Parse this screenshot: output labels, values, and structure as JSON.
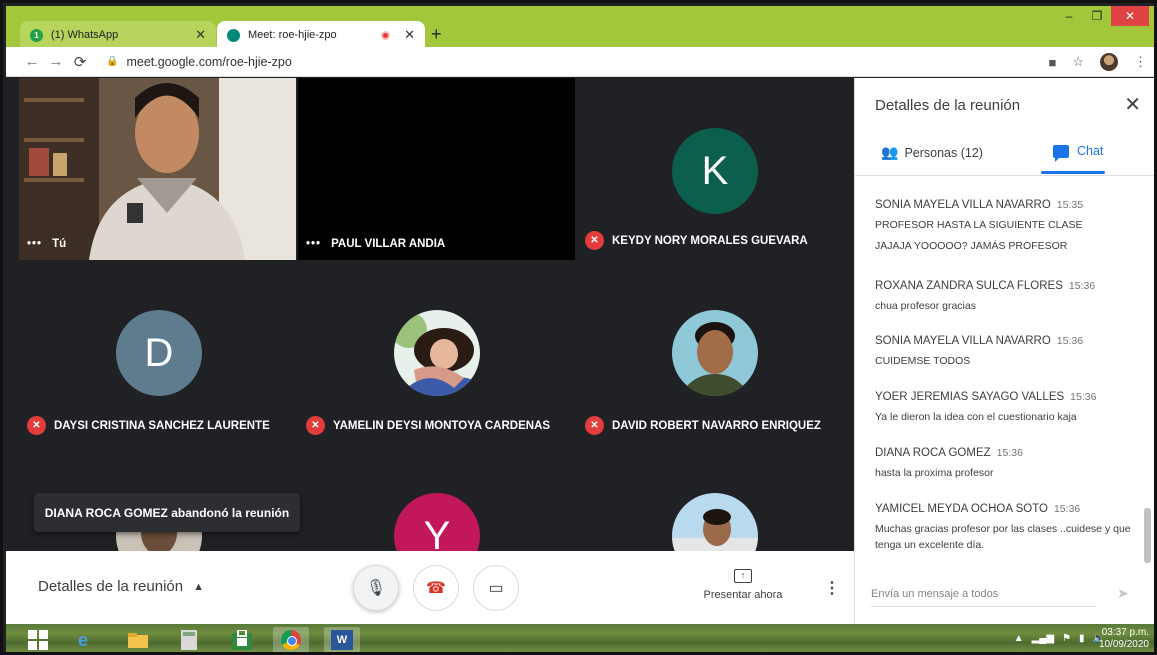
{
  "browser": {
    "tabs": [
      {
        "title": "(1) WhatsApp",
        "badge": "1",
        "active": false
      },
      {
        "title": "Meet: roe-hjie-zpo",
        "active": true,
        "recording": true
      }
    ],
    "new_tab": "+",
    "url": "meet.google.com/roe-hjie-zpo"
  },
  "meeting": {
    "tiles": [
      {
        "name": "Tú",
        "type": "video-self"
      },
      {
        "name": "PAUL VILLAR ANDIA",
        "type": "blank"
      },
      {
        "name": "KEYDY NORY MORALES GUEVARA",
        "type": "letter",
        "letter": "K",
        "color": "#0c5f4c",
        "muted": true
      },
      {
        "name": "DAYSI CRISTINA SANCHEZ LAURENTE",
        "type": "letter",
        "letter": "D",
        "color": "#5f7b8e",
        "muted": true
      },
      {
        "name": "YAMELIN DEYSI MONTOYA CARDENAS",
        "type": "photo",
        "muted": true
      },
      {
        "name": "DAVID ROBERT NAVARRO ENRIQUEZ",
        "type": "photo",
        "muted": true
      },
      {
        "name": "",
        "type": "photo-partial"
      },
      {
        "name": "",
        "type": "letter",
        "letter": "Y",
        "color": "#c2185b"
      },
      {
        "name": "",
        "type": "photo-partial"
      }
    ],
    "toast": "DIANA ROCA GOMEZ abandonó la reunión",
    "bottom": {
      "details_label": "Detalles de la reunión",
      "present_label": "Presentar ahora"
    }
  },
  "panel": {
    "title": "Detalles de la reunión",
    "people_tab": "Personas (12)",
    "chat_tab": "Chat",
    "messages": [
      {
        "sender": "SONIA MAYELA VILLA NAVARRO",
        "time": "15:35",
        "lines": [
          "PROFESOR  HASTA LA SIGUIENTE CLASE"
        ]
      },
      {
        "sender": "",
        "time": "",
        "lines": [
          "JAJAJA YOOOOO? JAMÁS PROFESOR"
        ]
      },
      {
        "sender": "ROXANA ZANDRA SULCA FLORES",
        "time": "15:36",
        "lines": [
          "chua profesor  gracias"
        ]
      },
      {
        "sender": "SONIA MAYELA VILLA NAVARRO",
        "time": "15:36",
        "lines": [
          " CUIDEMSE TODOS"
        ]
      },
      {
        "sender": "YOER JEREMIAS SAYAGO VALLES",
        "time": "15:36",
        "lines": [
          "Ya le dieron la idea con el cuestionario kaja"
        ]
      },
      {
        "sender": "DIANA ROCA GOMEZ",
        "time": "15:36",
        "lines": [
          "hasta la proxima profesor"
        ]
      },
      {
        "sender": "YAMICEL MEYDA OCHOA SOTO",
        "time": "15:36",
        "lines": [
          "Muchas gracias profesor por las clases ..cuidese y que tenga un excelente día."
        ]
      }
    ],
    "composer_placeholder": "Envía un mensaje a todos"
  },
  "taskbar": {
    "time": "03:37 p.m.",
    "date": "10/09/2020"
  },
  "colors": {
    "meet_bg": "#202124",
    "accent": "#1a73e8",
    "mute_red": "#e23c3c",
    "tabbar": "#a3c73b"
  }
}
